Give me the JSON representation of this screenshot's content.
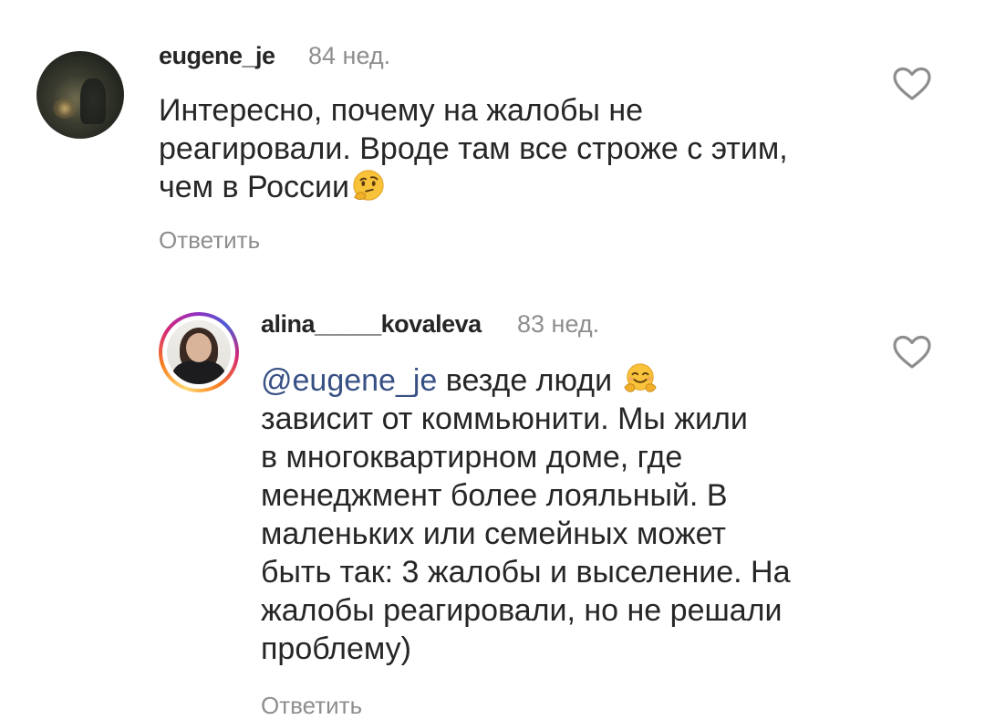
{
  "comments": [
    {
      "username": "eugene_je",
      "time": "84 нед.",
      "lines": [
        "Интересно, почему на жалобы не",
        "реагировали. Вроде там все строже с этим,",
        "чем в России"
      ],
      "trailing_emoji": "thinking-face",
      "reply_label": "Ответить",
      "like_icon": "heart-outline-icon"
    },
    {
      "username": "alina_____kovaleva",
      "time": "83 нед.",
      "mention": "@eugene_je",
      "first_line_text": " везде люди ",
      "first_line_emoji": "hugging-face",
      "lines": [
        "зависит от коммьюнити. Мы жили",
        "в многоквартирном доме, где",
        "менеджмент более лояльный. В",
        "маленьких или семейных может",
        "быть так: 3 жалобы и выселение. На",
        "жалобы реагировали, но не решали",
        "проблему)"
      ],
      "reply_label": "Ответить",
      "like_icon": "heart-outline-icon"
    }
  ],
  "colors": {
    "text": "#262626",
    "secondary": "#8e8e8e",
    "mention": "#385185",
    "background": "#ffffff"
  }
}
